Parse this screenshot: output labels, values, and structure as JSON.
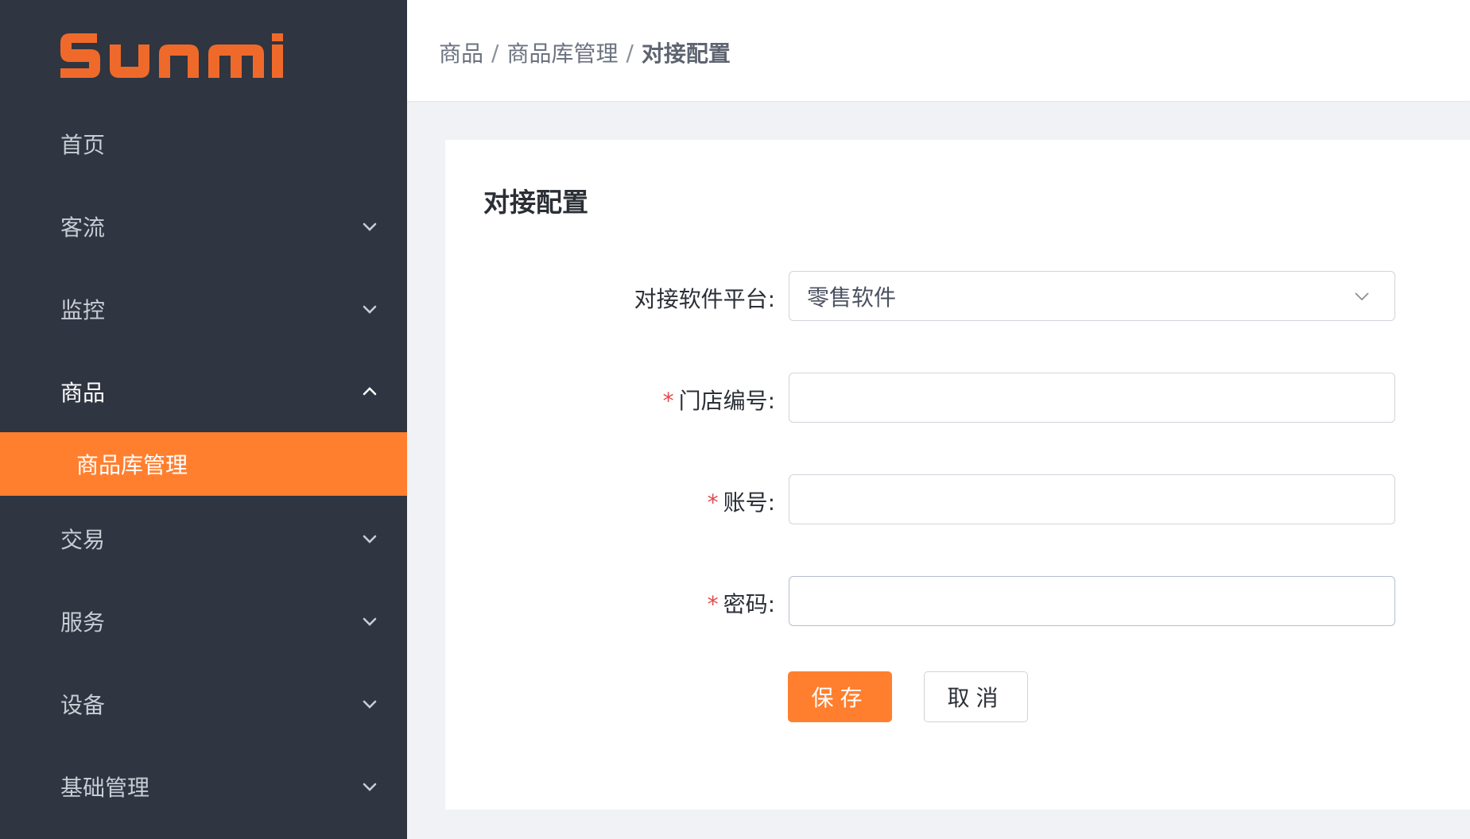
{
  "brand": {
    "name": "SUNMI",
    "color": "#ef6a2a"
  },
  "sidebar": {
    "items": [
      {
        "label": "首页",
        "icon": "none"
      },
      {
        "label": "客流",
        "icon": "chevron-down-icon"
      },
      {
        "label": "监控",
        "icon": "chevron-down-icon"
      },
      {
        "label": "商品",
        "icon": "chevron-up-icon",
        "expanded": true
      },
      {
        "label": "交易",
        "icon": "chevron-down-icon"
      },
      {
        "label": "服务",
        "icon": "chevron-down-icon"
      },
      {
        "label": "设备",
        "icon": "chevron-down-icon"
      },
      {
        "label": "基础管理",
        "icon": "chevron-down-icon"
      }
    ],
    "active_submenu": {
      "label": "商品库管理",
      "accent": "#ff7f2e"
    }
  },
  "breadcrumb": {
    "items": [
      "商品",
      "商品库管理"
    ],
    "separator": "/",
    "current": "对接配置"
  },
  "card": {
    "title": "对接配置",
    "form": {
      "platform": {
        "label": "对接软件平台:",
        "value": "零售软件"
      },
      "store_no": {
        "required_mark": "*",
        "label": "门店编号:",
        "value": ""
      },
      "account": {
        "required_mark": "*",
        "label": "账号:",
        "value": ""
      },
      "password": {
        "required_mark": "*",
        "label": "密码:",
        "value": ""
      }
    },
    "buttons": {
      "save": "保存",
      "cancel": "取消"
    }
  }
}
